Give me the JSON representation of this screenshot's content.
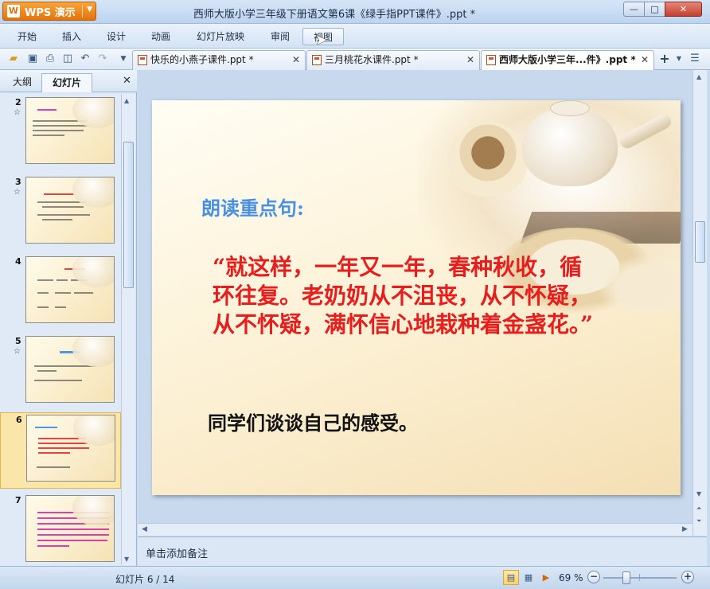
{
  "app": {
    "name": "WPS 演示",
    "logo_glyph": "W",
    "window_title": "西师大版小学三年级下册语文第6课《绿手指PPT课件》.ppt *",
    "controls": {
      "minimize": "—",
      "maximize": "□",
      "close": "✕"
    }
  },
  "menu": {
    "items": [
      "开始",
      "插入",
      "设计",
      "动画",
      "幻灯片放映",
      "审阅",
      "视图"
    ],
    "active_index": 6,
    "right": {
      "chevron": "∨",
      "help": "?",
      "settings": "⚙"
    }
  },
  "toolbar": {
    "icons": [
      "open-folder-icon",
      "save-icon",
      "print-icon",
      "print-preview-icon",
      "undo-icon",
      "redo-icon",
      "dropdown-icon"
    ]
  },
  "doc_tabs": [
    {
      "label": "快乐的小燕子课件.ppt *",
      "active": false
    },
    {
      "label": "三月桃花水课件.ppt *",
      "active": false
    },
    {
      "label": "西师大版小学三年...件》.ppt *",
      "active": true
    }
  ],
  "doc_tab_close": "✕",
  "doc_tab_add": "+",
  "left_panel": {
    "tabs": [
      "大纲",
      "幻灯片"
    ],
    "active_tab": 1,
    "close": "✕",
    "thumbnails": [
      {
        "number": "2",
        "star": "☆"
      },
      {
        "number": "3",
        "star": "☆"
      },
      {
        "number": "4",
        "star": ""
      },
      {
        "number": "5",
        "star": "☆"
      },
      {
        "number": "6",
        "star": ""
      },
      {
        "number": "7",
        "star": ""
      }
    ],
    "selected_number": "6"
  },
  "slide": {
    "heading": "朗读重点句:",
    "quote": "“就这样，一年又一年，春种秋收，循环往复。老奶奶从不沮丧，从不怀疑，从不怀疑，满怀信心地栽种着金盏花。”",
    "prompt": "同学们谈谈自己的感受。",
    "colors": {
      "heading": "#4a90e2",
      "quote": "#e81e1e",
      "prompt": "#111111"
    }
  },
  "notes": {
    "placeholder": "单击添加备注"
  },
  "status": {
    "slide_indicator": "幻灯片 6 / 14",
    "zoom": "69 %",
    "zoom_minus": "−",
    "zoom_plus": "+"
  }
}
